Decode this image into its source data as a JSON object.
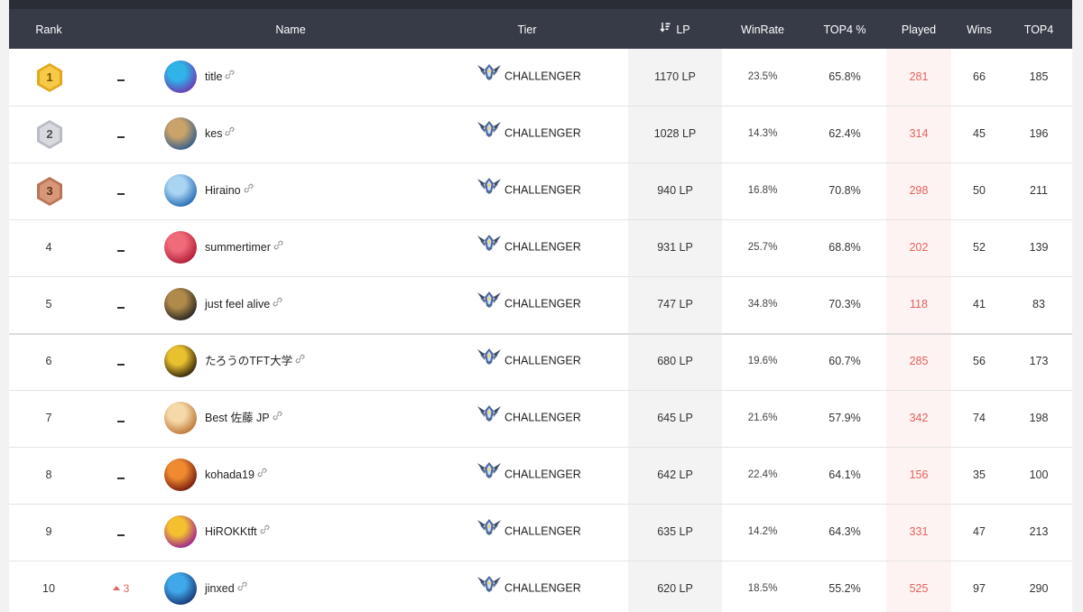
{
  "header": {
    "rank": "Rank",
    "name": "Name",
    "tier": "Tier",
    "lp": "LP",
    "winrate": "WinRate",
    "top4_pct": "TOP4 %",
    "played": "Played",
    "wins": "Wins",
    "top4": "TOP4"
  },
  "colors": {
    "header_bg": "#373b47",
    "played_text": "#e5625c",
    "rank_up": "#e5625c",
    "gold": "#f7c948",
    "silver": "#d8dade",
    "bronze": "#d9977a"
  },
  "rows": [
    {
      "rank": "1",
      "change": "",
      "name": "title",
      "tier": "CHALLENGER",
      "lp": "1170 LP",
      "winrate": "23.5%",
      "top4_pct": "65.8%",
      "played": "281",
      "wins": "66",
      "top4": "185",
      "medal": "gold",
      "avatar": [
        "#6a3fb5",
        "#2fb3e8"
      ]
    },
    {
      "rank": "2",
      "change": "",
      "name": "kes",
      "tier": "CHALLENGER",
      "lp": "1028 LP",
      "winrate": "14.3%",
      "top4_pct": "62.4%",
      "played": "314",
      "wins": "45",
      "top4": "196",
      "medal": "silver",
      "avatar": [
        "#3b5f8a",
        "#c9a36a"
      ]
    },
    {
      "rank": "3",
      "change": "",
      "name": "Hiraino",
      "tier": "CHALLENGER",
      "lp": "940 LP",
      "winrate": "16.8%",
      "top4_pct": "70.8%",
      "played": "298",
      "wins": "50",
      "top4": "211",
      "medal": "bronze",
      "avatar": [
        "#2b6fb8",
        "#a9d4f2"
      ]
    },
    {
      "rank": "4",
      "change": "",
      "name": "summertimer",
      "tier": "CHALLENGER",
      "lp": "931 LP",
      "winrate": "25.7%",
      "top4_pct": "68.8%",
      "played": "202",
      "wins": "52",
      "top4": "139",
      "medal": "",
      "avatar": [
        "#b3203a",
        "#f06a7a"
      ]
    },
    {
      "rank": "5",
      "change": "",
      "name": "just feel alive",
      "tier": "CHALLENGER",
      "lp": "747 LP",
      "winrate": "34.8%",
      "top4_pct": "70.3%",
      "played": "118",
      "wins": "41",
      "top4": "83",
      "medal": "",
      "avatar": [
        "#2e2a24",
        "#b08a4a"
      ]
    },
    {
      "rank": "6",
      "change": "",
      "name": "たろうのTFT大学",
      "tier": "CHALLENGER",
      "lp": "680 LP",
      "winrate": "19.6%",
      "top4_pct": "60.7%",
      "played": "285",
      "wins": "56",
      "top4": "173",
      "medal": "",
      "avatar": [
        "#3a2a0c",
        "#e8c030"
      ]
    },
    {
      "rank": "7",
      "change": "",
      "name": "Best 佐藤 JP",
      "tier": "CHALLENGER",
      "lp": "645 LP",
      "winrate": "21.6%",
      "top4_pct": "57.9%",
      "played": "342",
      "wins": "74",
      "top4": "198",
      "medal": "",
      "avatar": [
        "#c07a3a",
        "#f5d9a8"
      ]
    },
    {
      "rank": "8",
      "change": "",
      "name": "kohada19",
      "tier": "CHALLENGER",
      "lp": "642 LP",
      "winrate": "22.4%",
      "top4_pct": "64.1%",
      "played": "156",
      "wins": "35",
      "top4": "100",
      "medal": "",
      "avatar": [
        "#7a1e10",
        "#f08a30"
      ]
    },
    {
      "rank": "9",
      "change": "",
      "name": "HiROKKtft",
      "tier": "CHALLENGER",
      "lp": "635 LP",
      "winrate": "14.2%",
      "top4_pct": "64.3%",
      "played": "331",
      "wins": "47",
      "top4": "213",
      "medal": "",
      "avatar": [
        "#a02a8a",
        "#f4c030"
      ]
    },
    {
      "rank": "10",
      "change": "3",
      "name": "jinxed",
      "tier": "CHALLENGER",
      "lp": "620 LP",
      "winrate": "18.5%",
      "top4_pct": "55.2%",
      "played": "525",
      "wins": "97",
      "top4": "290",
      "medal": "",
      "avatar": [
        "#1a3a7a",
        "#40a8e8"
      ]
    }
  ]
}
